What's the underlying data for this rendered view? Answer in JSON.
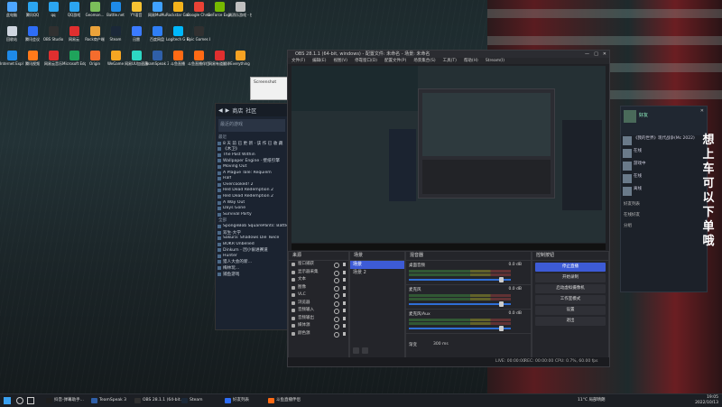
{
  "desktop": {
    "icons": [
      {
        "label": "此电脑",
        "color": "#4da6ff"
      },
      {
        "label": "腾讯QQ",
        "color": "#2ba5f0"
      },
      {
        "label": "qq",
        "color": "#2ba5f0"
      },
      {
        "label": "QQ游戏",
        "color": "#2ba5f0"
      },
      {
        "label": "Geomon...",
        "color": "#7bbf5a"
      },
      {
        "label": "Battle.net",
        "color": "#1e8ae8"
      },
      {
        "label": "YY语音",
        "color": "#f6c232"
      },
      {
        "label": "网易MuMu",
        "color": "#3fa1ff"
      },
      {
        "label": "Rockstar Games...",
        "color": "#f3b31b"
      },
      {
        "label": "Google Chrome",
        "color": "#e94235"
      },
      {
        "label": "GeForce Experience",
        "color": "#76b900"
      },
      {
        "label": "消消乐游戏 - 快捷方式",
        "color": "#c0c0c0"
      },
      {
        "label": "回收站",
        "color": "#cfd6df"
      },
      {
        "label": "腾讯会议",
        "color": "#2e6df6"
      },
      {
        "label": "OBS Studio",
        "color": "#303030"
      },
      {
        "label": "网易云",
        "color": "#e02f2f"
      },
      {
        "label": "Rock商户端",
        "color": "#eaa23a"
      },
      {
        "label": "Steam",
        "color": "#1b2838"
      },
      {
        "label": "迅雷",
        "color": "#3b7bff"
      },
      {
        "label": "百度网盘",
        "color": "#2f7ff6"
      },
      {
        "label": "Logitech G HUB",
        "color": "#00b8fc"
      },
      {
        "label": "Epic Games Launcher",
        "color": "#303030"
      },
      {
        "label": "Internet Explorer",
        "color": "#1e8ae8"
      },
      {
        "label": "腾讯视频",
        "color": "#ff7a1a"
      },
      {
        "label": "网易云音乐",
        "color": "#e02f2f"
      },
      {
        "label": "Microsoft Edge",
        "color": "#1fa35b"
      },
      {
        "label": "Origin",
        "color": "#f56c2d"
      },
      {
        "label": "WeGame",
        "color": "#f5a623"
      },
      {
        "label": "网易UU加速器",
        "color": "#2dd7c4"
      },
      {
        "label": "TeamSpeak 3",
        "color": "#2f5fa8"
      },
      {
        "label": "斗鱼直播",
        "color": "#ff6a14"
      },
      {
        "label": "斗鱼直播伴侣",
        "color": "#ff6a14"
      },
      {
        "label": "网易有道翻译",
        "color": "#e02f2f"
      },
      {
        "label": "Everything",
        "color": "#f6a223"
      }
    ]
  },
  "steam": {
    "tabs": [
      "商店",
      "社区"
    ],
    "filter": "最近的游戏",
    "section_recent": "最近",
    "games": [
      "8 天 前 已 更 新 · 该 作 已 收 藏",
      "《木卫》",
      "The Past Within",
      "Wallpaper Engine · 壁纸引擎",
      "Moving Out",
      "A Plague Tale: Requiem",
      "Half",
      "Overcooked! 2",
      "Red Dead Redemption 2",
      "Red Dead Redemption 2",
      "A Way Out",
      "Days Gone",
      "Survival Party"
    ],
    "section_all": "全部",
    "games2": [
      "SpongeBob SquarePants: Battle f",
      "双生·大学",
      "Sakura: Shadows Die Twice",
      "BOKR Unbelied",
      "Dinkum - 因小偷进赛道",
      "Hunter",
      "猎人大会的新…",
      "梅林玩…",
      "捕鱼游戏"
    ]
  },
  "popup": {
    "text": "Screenshot"
  },
  "obs": {
    "title": "OBS 28.1.1 (64-bit, windows) - 配置文件: 未命名 - 场景: 未命名",
    "menu": [
      "文件(F)",
      "编辑(E)",
      "视图(V)",
      "停靠窗口(D)",
      "配置文件(P)",
      "场景集合(S)",
      "工具(T)",
      "帮助(H)",
      "Stream(I)"
    ],
    "docks": {
      "scenes_title": "场景",
      "scenes": [
        "场景",
        "场景 2"
      ],
      "sources_title": "来源",
      "sources": [
        "窗口捕获",
        "显示器采集",
        "文本",
        "图像",
        "VLC",
        "浏览器",
        "音频输入",
        "音频输出",
        "媒体源",
        "颜色源"
      ],
      "mixer_title": "混音器",
      "mixer": [
        {
          "name": "桌面音频",
          "db": "0.0 dB"
        },
        {
          "name": "麦克风",
          "db": "0.0 dB"
        },
        {
          "name": "麦克风/Aux",
          "db": "0.0 dB"
        }
      ],
      "transition_title": "转场特效",
      "controls_title": "控制按钮",
      "controls": [
        "停止直播",
        "开始录制",
        "启动虚拟摄像机",
        "工作室模式",
        "设置",
        "退出"
      ]
    },
    "status": {
      "live": "LIVE: 00:00:00",
      "rec": "REC: 00:00:00",
      "cpu": "CPU: 0.7%, 60.00 fps"
    },
    "transition_item": "渐变",
    "transition_duration": "300 ms"
  },
  "chat": {
    "user": "好友",
    "messages": [
      "《我的世界》现代战争(Mc 2022)",
      "在线",
      "游戏中",
      "在线",
      "离线"
    ],
    "groups": "分组",
    "friends": "好友列表",
    "online": "在线好友"
  },
  "overlay": {
    "vertical_text": "想上车可以下单哦"
  },
  "taskbar": {
    "items": [
      {
        "label": "抖音-弹幕助手...",
        "color": "#1e1e1e"
      },
      {
        "label": "TeamSpeak 3",
        "color": "#2f5fa8"
      },
      {
        "label": "OBS 28.1.1 (64-bit...",
        "color": "#303030"
      },
      {
        "label": "Steam",
        "color": "#1b2838"
      },
      {
        "label": "好友列表",
        "color": "#2e6df6"
      },
      {
        "label": "斗鱼直播伴侣",
        "color": "#ff6a14"
      }
    ],
    "weather": "11°C 局部晴朗",
    "time": "19:05",
    "date": "2022/10/13"
  }
}
